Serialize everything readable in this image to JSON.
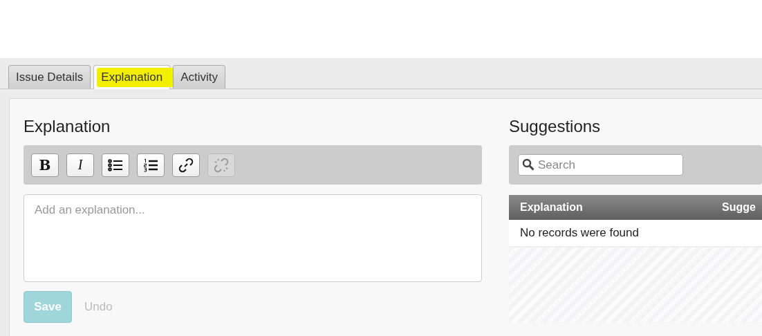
{
  "tabs": [
    {
      "label": "Issue Details",
      "selected": false,
      "highlighted": false
    },
    {
      "label": "Explanation",
      "selected": true,
      "highlighted": true
    },
    {
      "label": "Activity",
      "selected": false,
      "highlighted": false
    }
  ],
  "explanation": {
    "title": "Explanation",
    "toolbar": [
      {
        "kind": "bold",
        "label": "B",
        "disabled": false
      },
      {
        "kind": "italic",
        "label": "I",
        "disabled": false
      },
      {
        "kind": "bullets",
        "disabled": false
      },
      {
        "kind": "numbers",
        "disabled": false
      },
      {
        "kind": "link",
        "disabled": false
      },
      {
        "kind": "unlink",
        "disabled": true
      }
    ],
    "editor": {
      "placeholder": "Add an explanation..."
    },
    "save": {
      "label": "Save",
      "disabled": true
    },
    "undo": {
      "label": "Undo",
      "disabled": true
    }
  },
  "suggestions": {
    "title": "Suggestions",
    "search": {
      "placeholder": "Search"
    },
    "table": {
      "columns": [
        "Explanation",
        "Sugge"
      ],
      "empty_message": "No records were found"
    }
  }
}
